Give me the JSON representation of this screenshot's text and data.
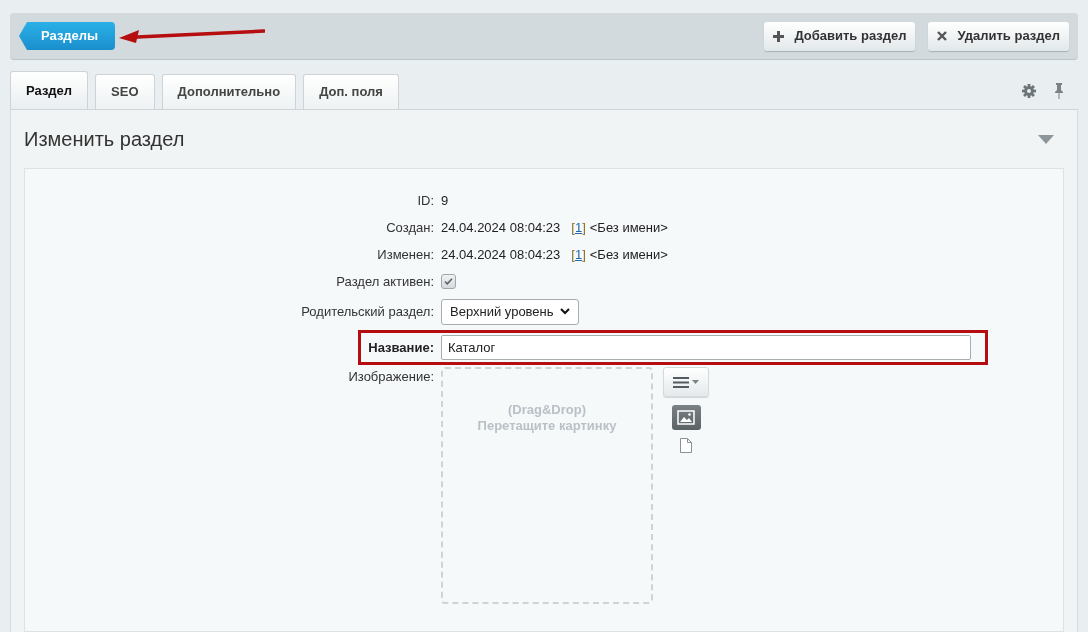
{
  "toolbar": {
    "back_button": {
      "label": "Разделы",
      "annotated": true
    },
    "actions": [
      {
        "kind": "add",
        "label": "Добавить раздел"
      },
      {
        "kind": "delete",
        "label": "Удалить раздел"
      }
    ]
  },
  "tabs": [
    {
      "label": "Раздел",
      "selected": true
    },
    {
      "label": "SEO",
      "selected": false
    },
    {
      "label": "Дополнительно",
      "selected": false
    },
    {
      "label": "Доп. поля",
      "selected": false
    }
  ],
  "form": {
    "title": "Изменить раздел",
    "rows": [
      {
        "kind": "text",
        "label": "ID:",
        "value": "9"
      },
      {
        "kind": "author",
        "label": "Создан:",
        "date": "24.04.2024 08:04:23",
        "bracket_open": "[",
        "user_id": "1",
        "bracket_close": "]",
        "user_name": "<Без имени>"
      },
      {
        "kind": "author",
        "label": "Изменен:",
        "date": "24.04.2024 08:04:23",
        "bracket_open": "[",
        "user_id": "1",
        "bracket_close": "]",
        "user_name": "<Без имени>"
      },
      {
        "kind": "checkbox",
        "label": "Раздел активен:",
        "checked": true
      },
      {
        "kind": "select",
        "label": "Родительский раздел:",
        "value": "Верхний уровень"
      },
      {
        "kind": "input",
        "label": "Название:",
        "value": "Каталог",
        "required": true,
        "highlighted": true
      },
      {
        "kind": "image",
        "label": "Изображение:",
        "drop_hint": "(Drag&Drop)",
        "drop_text": "Перетащите картинку"
      }
    ]
  }
}
